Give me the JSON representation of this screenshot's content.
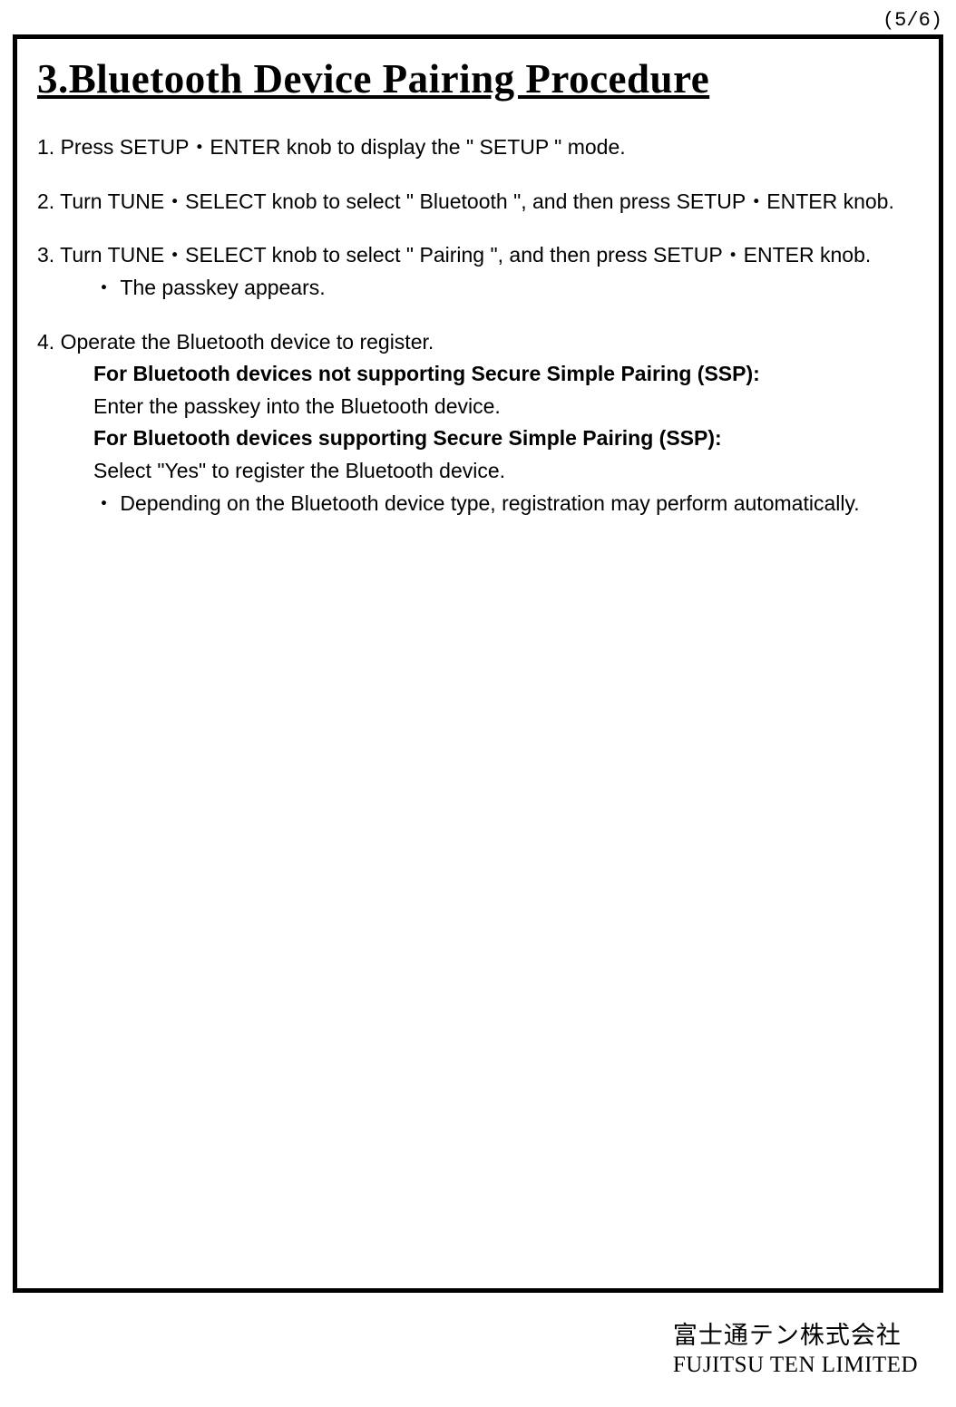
{
  "pageNumber": "(5/6)",
  "title": "3.Bluetooth Device Pairing Procedure",
  "steps": {
    "s1": "1.   Press  SETUP・ENTER knob to display the \" SETUP \" mode.",
    "s2": "2.    Turn TUNE・SELECT knob to select \" Bluetooth \", and then press SETUP・ENTER knob.",
    "s3": "3. Turn TUNE・SELECT knob to select \" Pairing \", and then press SETUP・ENTER knob.",
    "s3a": "・ The passkey appears.",
    "s4": "4.    Operate the Bluetooth device to register.",
    "s4b1": "For Bluetooth devices not supporting Secure Simple Pairing (SSP):",
    "s4t1": "Enter the passkey into the Bluetooth device.",
    "s4b2": "For Bluetooth devices supporting Secure Simple Pairing (SSP):",
    "s4t2": "Select \"Yes\" to register the Bluetooth device.",
    "s4t3": " ・ Depending on the Bluetooth device type, registration may perform automatically."
  },
  "footer": {
    "jp": "富士通テン株式会社",
    "en": "FUJITSU TEN LIMITED"
  }
}
